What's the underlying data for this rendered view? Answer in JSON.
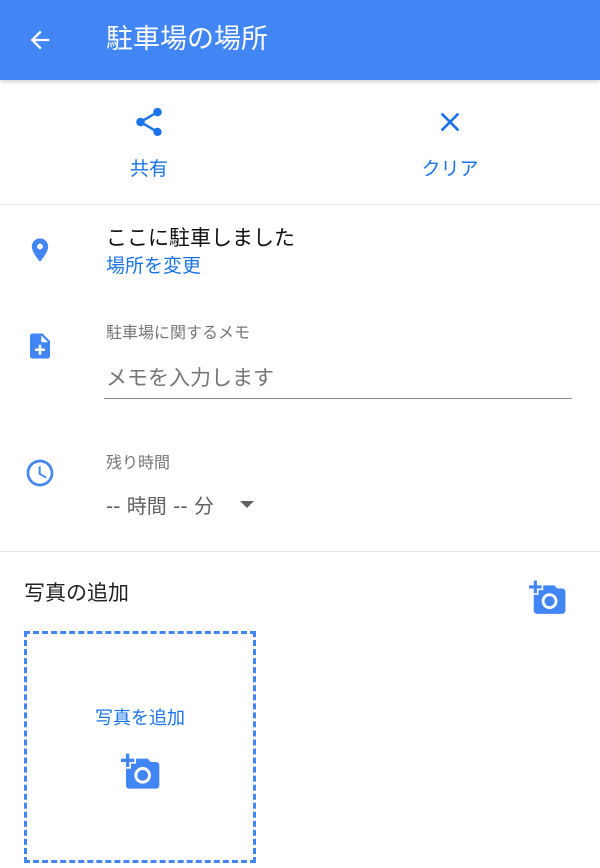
{
  "appbar": {
    "title": "駐車場の場所",
    "back_icon": "arrow-back-icon",
    "background_color": "#4285f4"
  },
  "actions": {
    "share": {
      "label": "共有",
      "icon": "share-icon"
    },
    "clear": {
      "label": "クリア",
      "icon": "close-icon"
    }
  },
  "location": {
    "icon": "location-pin-icon",
    "title": "ここに駐車しました",
    "change_link": "場所を変更"
  },
  "memo": {
    "icon": "note-add-icon",
    "label": "駐車場に関するメモ",
    "placeholder": "メモを入力します",
    "value": ""
  },
  "time": {
    "icon": "clock-icon",
    "label": "残り時間",
    "selected": "-- 時間 -- 分"
  },
  "photos": {
    "title": "写真の追加",
    "add_icon": "add-a-photo-icon",
    "dropzone_label": "写真を追加"
  },
  "colors": {
    "accent": "#4285f4",
    "link": "#1a73e8",
    "secondary_text": "#757575"
  }
}
